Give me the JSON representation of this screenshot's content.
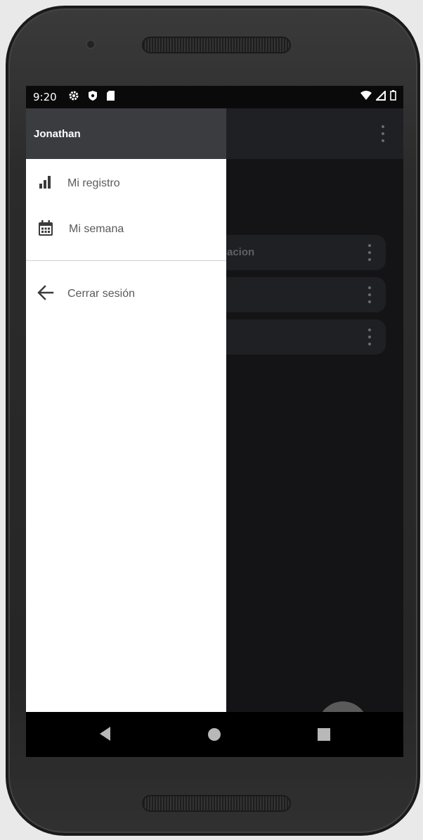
{
  "status_bar": {
    "time": "9:20"
  },
  "drawer": {
    "header_name": "Jonathan",
    "items": [
      {
        "label": "Mi registro",
        "icon": "bar-chart-icon"
      },
      {
        "label": "Mi semana",
        "icon": "calendar-icon"
      },
      {
        "label": "Cerrar sesión",
        "icon": "arrow-left-icon"
      }
    ]
  },
  "app": {
    "cards": [
      {
        "label": "acion"
      },
      {
        "label": ""
      },
      {
        "label": ""
      }
    ]
  },
  "colors": {
    "drawer_header": "#3b3c40",
    "app_background": "#141416",
    "fab": "#5a5a5a"
  }
}
